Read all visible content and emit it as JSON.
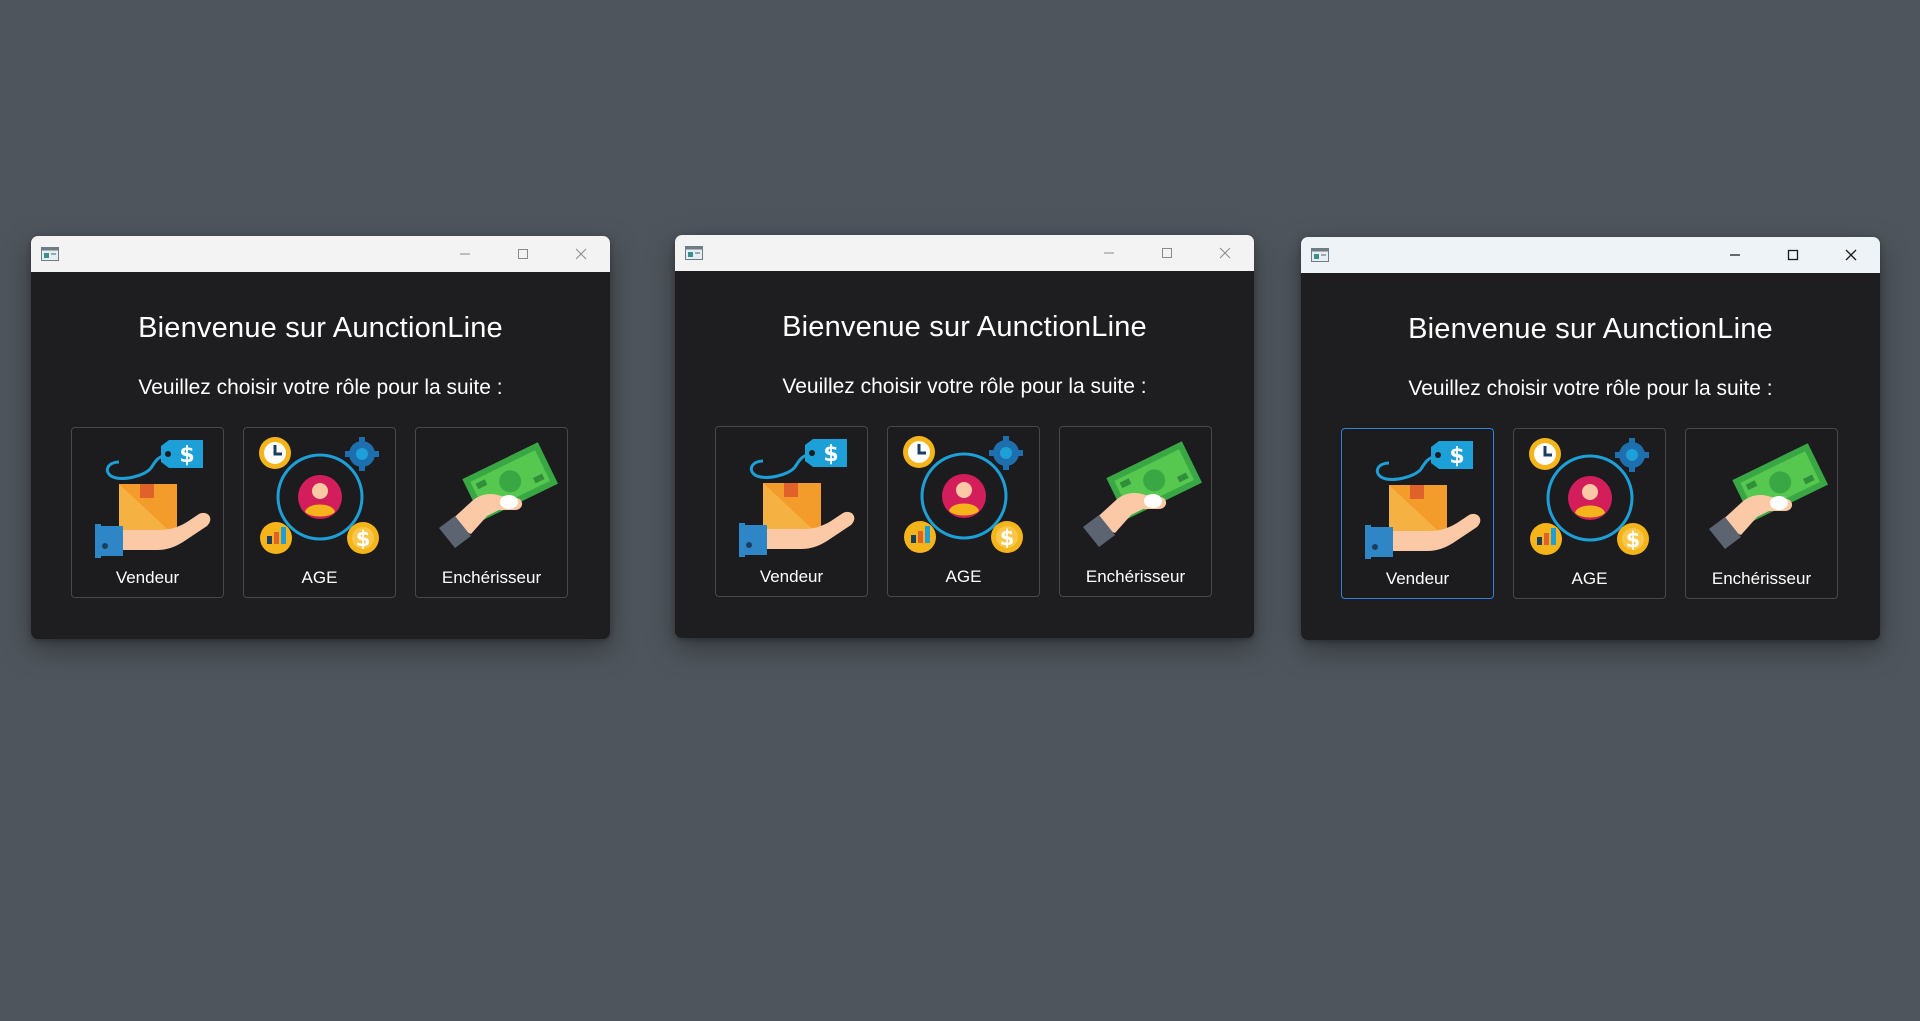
{
  "windows": [
    {
      "title": "Bienvenue sur AunctionLine",
      "subtitle": "Veuillez choisir votre rôle pour la suite :",
      "roles": [
        {
          "label": "Vendeur",
          "icon": "seller-icon"
        },
        {
          "label": "AGE",
          "icon": "agent-icon"
        },
        {
          "label": "Enchérisseur",
          "icon": "bidder-icon"
        }
      ],
      "focused_role": null
    },
    {
      "title": "Bienvenue sur AunctionLine",
      "subtitle": "Veuillez choisir votre rôle pour la suite :",
      "roles": [
        {
          "label": "Vendeur",
          "icon": "seller-icon"
        },
        {
          "label": "AGE",
          "icon": "agent-icon"
        },
        {
          "label": "Enchérisseur",
          "icon": "bidder-icon"
        }
      ],
      "focused_role": null
    },
    {
      "title": "Bienvenue sur AunctionLine",
      "subtitle": "Veuillez choisir votre rôle pour la suite :",
      "roles": [
        {
          "label": "Vendeur",
          "icon": "seller-icon"
        },
        {
          "label": "AGE",
          "icon": "agent-icon"
        },
        {
          "label": "Enchérisseur",
          "icon": "bidder-icon"
        }
      ],
      "focused_role": "Vendeur"
    }
  ],
  "colors": {
    "desktop_background": "#4e555c",
    "window_background": "#1e1e20",
    "focus_border": "#2f7fdc"
  }
}
